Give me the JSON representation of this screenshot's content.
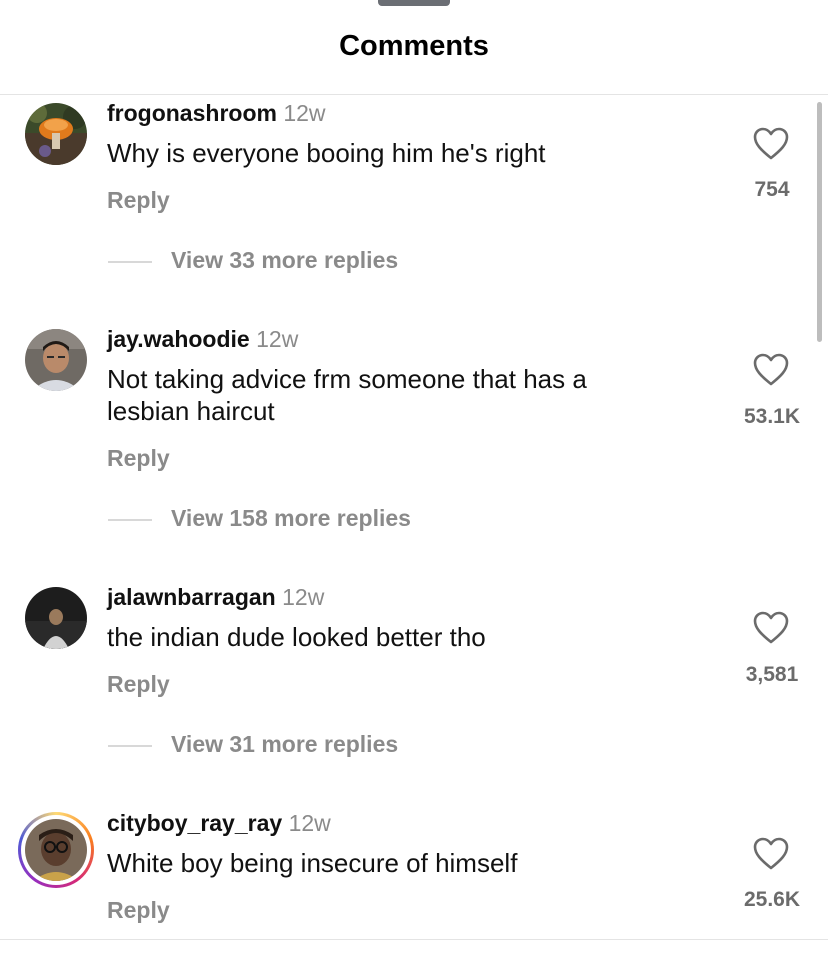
{
  "header": {
    "title": "Comments"
  },
  "comments": [
    {
      "username": "frogonashroom",
      "time": "12w",
      "text": "Why is everyone booing him he's right",
      "reply_label": "Reply",
      "likes": "754",
      "view_replies": "View 33 more replies",
      "avatar_icon": "mushroom-photo",
      "story_ring": false
    },
    {
      "username": "jay.wahoodie",
      "time": "12w",
      "text": "Not taking advice frm someone that has a lesbian haircut",
      "reply_label": "Reply",
      "likes": "53.1K",
      "view_replies": "View 158 more replies",
      "avatar_icon": "selfie-photo",
      "story_ring": false
    },
    {
      "username": "jalawnbarragan",
      "time": "12w",
      "text": "the indian dude looked better tho",
      "reply_label": "Reply",
      "likes": "3,581",
      "view_replies": "View 31 more replies",
      "avatar_icon": "dark-person-photo",
      "story_ring": false
    },
    {
      "username": "cityboy_ray_ray",
      "time": "12w",
      "text": "White boy being insecure of himself",
      "reply_label": "Reply",
      "likes": "25.6K",
      "avatar_icon": "glasses-person-photo",
      "story_ring": true
    }
  ],
  "colors": {
    "secondary_text": "#8a8a8a",
    "story_ring": [
      "#feda75",
      "#fa7e1e",
      "#d62976",
      "#962fbf",
      "#4f5bd5"
    ]
  }
}
